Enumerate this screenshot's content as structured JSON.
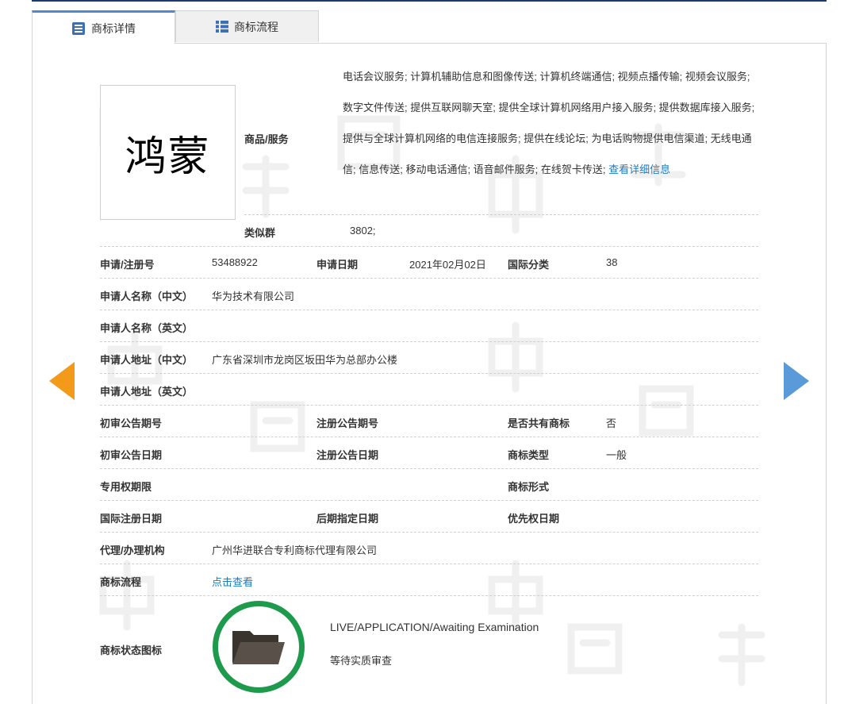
{
  "tabs": [
    {
      "label": "商标详情",
      "icon": "list-doc-icon",
      "active": true
    },
    {
      "label": "商标流程",
      "icon": "list-grid-icon",
      "active": false
    }
  ],
  "logo": {
    "text": "鸿蒙"
  },
  "goods": {
    "label": "商品/服务",
    "text": "电话会议服务; 计算机辅助信息和图像传送; 计算机终端通信; 视频点播传输; 视频会议服务; 数字文件传送; 提供互联网聊天室; 提供全球计算机网络用户接入服务; 提供数据库接入服务; 提供与全球计算机网络的电信连接服务; 提供在线论坛; 为电话购物提供电信渠道; 无线电通信; 信息传送; 移动电话通信; 语音邮件服务; 在线贺卡传送; ",
    "more_link": "查看详细信息"
  },
  "similar_group": {
    "label": "类似群",
    "value": "3802;"
  },
  "fields": {
    "reg_no_label": "申请/注册号",
    "reg_no": "53488922",
    "apply_date_label": "申请日期",
    "apply_date": "2021年02月02日",
    "intl_class_label": "国际分类",
    "intl_class": "38",
    "applicant_cn_label": "申请人名称（中文）",
    "applicant_cn": "华为技术有限公司",
    "applicant_en_label": "申请人名称（英文）",
    "applicant_en": "",
    "address_cn_label": "申请人地址（中文）",
    "address_cn": "广东省深圳市龙岗区坂田华为总部办公楼",
    "address_en_label": "申请人地址（英文）",
    "address_en": "",
    "prelim_no_label": "初审公告期号",
    "prelim_no": "",
    "reg_pub_no_label": "注册公告期号",
    "reg_pub_no": "",
    "shared_label": "是否共有商标",
    "shared": "否",
    "prelim_date_label": "初审公告日期",
    "prelim_date": "",
    "reg_pub_date_label": "注册公告日期",
    "reg_pub_date": "",
    "tm_type_label": "商标类型",
    "tm_type": "一般",
    "exclusive_period_label": "专用权期限",
    "exclusive_period": "",
    "tm_form_label": "商标形式",
    "tm_form": "",
    "intl_reg_date_label": "国际注册日期",
    "intl_reg_date": "",
    "later_designation_label": "后期指定日期",
    "later_designation": "",
    "priority_date_label": "优先权日期",
    "priority_date": "",
    "agent_label": "代理/办理机构",
    "agent": "广州华进联合专利商标代理有限公司",
    "process_label": "商标流程",
    "process_link": "点击查看",
    "status_icon_label": "商标状态图标"
  },
  "status": {
    "en": "LIVE/APPLICATION/Awaiting Examination",
    "cn": "等待实质审查",
    "icon": "open-folder-icon",
    "ring_color": "#1e9a4c"
  },
  "nav": {
    "prev_icon": "arrow-left-icon",
    "next_icon": "arrow-right-icon",
    "prev_color": "#f39a1a",
    "next_color": "#5a9ad8"
  }
}
